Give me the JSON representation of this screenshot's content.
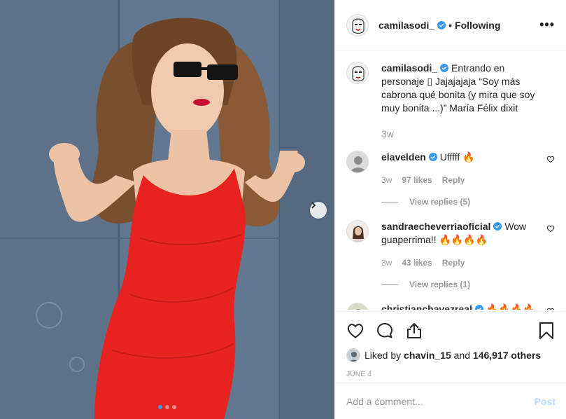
{
  "post": {
    "username": "camilasodi_",
    "follow_sep": "•",
    "follow_label": "Following",
    "more_label": "•••",
    "carousel": {
      "total": 3,
      "current": 1
    }
  },
  "caption": {
    "username": "camilasodi_",
    "text": "Entrando en personaje ▯ Jajajajaja “Soy más cabrona qué bonita (y mira que soy muy bonita ...)” María Félix dixit",
    "time": "3w"
  },
  "comments": [
    {
      "username": "elavelden",
      "verified": true,
      "text": "Ufffff 🔥",
      "time": "3w",
      "likes": "97 likes",
      "reply": "Reply",
      "view_replies": "View replies (5)"
    },
    {
      "username": "sandraecheverriaoficial",
      "verified": true,
      "text": "Wow guaperrima!! 🔥🔥🔥🔥",
      "time": "3w",
      "likes": "43 likes",
      "reply": "Reply",
      "view_replies": "View replies (1)"
    },
    {
      "username": "christianchavezreal",
      "verified": true,
      "text": "🔥🔥🔥🔥🔥",
      "time": "",
      "likes": "",
      "reply": "",
      "view_replies": ""
    }
  ],
  "likes": {
    "prefix": "Liked by ",
    "user": "chavin_15",
    "mid": " and ",
    "count": "146,917 others"
  },
  "date": "JUNE 4",
  "add_comment": {
    "placeholder": "Add a comment...",
    "post_label": "Post"
  },
  "colors": {
    "accent": "#3897f0",
    "post_disabled": "#b3dbff",
    "muted": "#999999",
    "border": "#efefef",
    "dress": "#e8231f"
  },
  "icons": [
    "chevron-right-icon",
    "verified-badge-icon",
    "heart-icon",
    "comment-icon",
    "share-icon",
    "bookmark-icon"
  ]
}
